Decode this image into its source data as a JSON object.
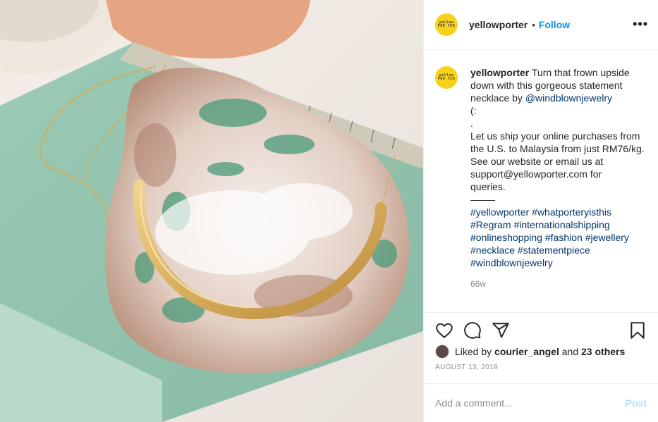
{
  "post": {
    "username": "yellowporter",
    "avatar_text": "yellow POR TER",
    "separator": "•",
    "follow_label": "Follow",
    "more_label": "•••"
  },
  "caption": {
    "username": "yellowporter",
    "line1": "Turn that frown upside",
    "line2": "down with this gorgeous statement",
    "line3_prefix": "necklace by ",
    "mention": "@windblownjewelry",
    "line4": "(:",
    "line5": ".",
    "line6": "Let us ship your online purchases from",
    "line7": "the U.S. to Malaysia from just RM76/kg.",
    "line8": "See our website or email us at",
    "line9": "support@yellowporter.com for",
    "line10": "queries.",
    "line11": "⎯⎯⎯⎯⎯",
    "tags": [
      "#yellowporter #whatporteryisthis",
      "#Regram #internationalshipping",
      "#onlineshopping #fashion #jewellery",
      "#necklace #statementpiece",
      "#windblownjewelry"
    ],
    "time_ago": "66w"
  },
  "engagement": {
    "liked_by_prefix": "Liked by",
    "liked_by_user": "courier_angel",
    "and": "and",
    "others": "23 others",
    "date": "AUGUST 13, 2019"
  },
  "comment": {
    "placeholder": "Add a comment...",
    "post_label": "Post"
  },
  "colors": {
    "accent": "#0095f6",
    "tag": "#00376b",
    "avatar_bg": "#f7d21a"
  }
}
